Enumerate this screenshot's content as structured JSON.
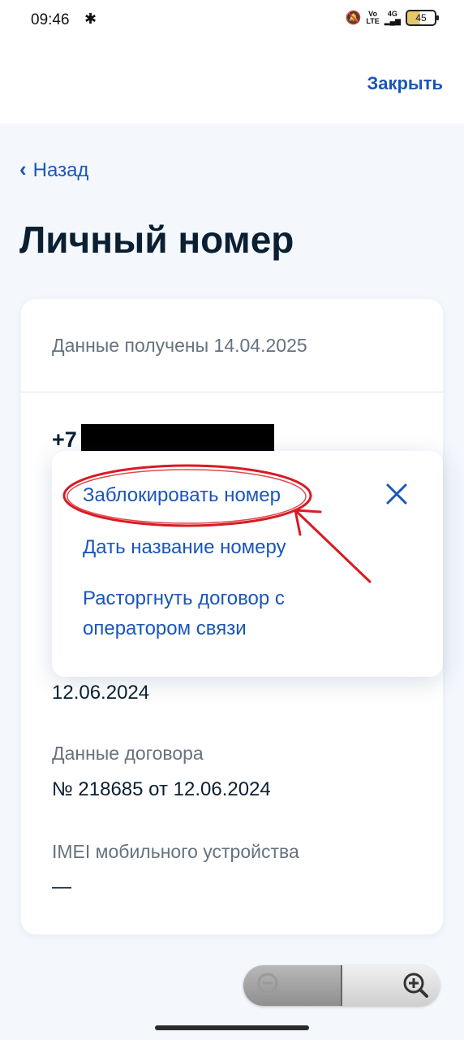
{
  "status_bar": {
    "time": "09:46",
    "network_top": "Vo",
    "network_bottom": "LTE",
    "signal_label": "4G",
    "battery": "45"
  },
  "header": {
    "close_label": "Закрыть"
  },
  "nav": {
    "back_label": "Назад"
  },
  "page": {
    "title": "Личный номер"
  },
  "card": {
    "received": "Данные получены 14.04.2025",
    "phone_prefix": "+7",
    "date_value": "12.06.2024",
    "contract_label": "Данные договора",
    "contract_value": "№ 218685 от 12.06.2024",
    "imei_label": "IMEI мобильного устройства",
    "imei_value": "—"
  },
  "popup": {
    "items": [
      {
        "label": "Заблокировать номер"
      },
      {
        "label": "Дать название номеру"
      },
      {
        "label": "Расторгнуть договор с оператором связи"
      }
    ]
  },
  "colors": {
    "accent": "#1a56b8",
    "title": "#0b1f33",
    "muted": "#66727f",
    "annotation": "#d81b23"
  }
}
